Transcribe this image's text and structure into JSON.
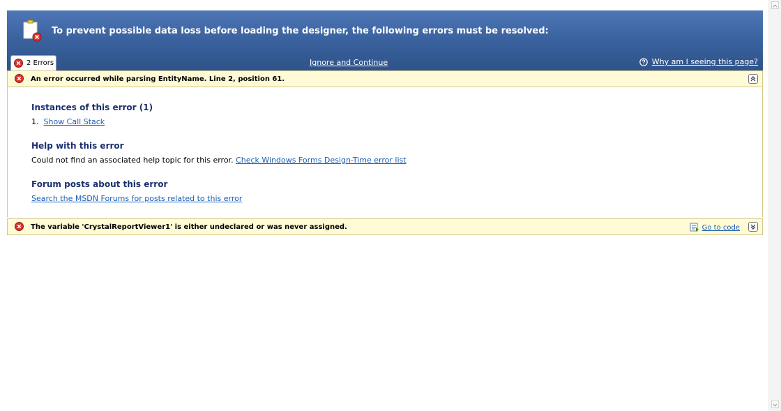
{
  "header": {
    "title": "To prevent possible data loss before loading the designer, the following errors must be resolved:",
    "tab_label": "2 Errors",
    "ignore_link": "Ignore and Continue",
    "help_link": "Why am I seeing this page?",
    "icons": {
      "document": "document-error-icon",
      "help": "question-circle-icon"
    }
  },
  "errors": [
    {
      "message": "An error occurred while parsing EntityName. Line 2, position 61.",
      "expanded": true,
      "toggle_icon": "chevron-up-double-icon",
      "instances_title": "Instances of this error (1)",
      "instance_number": "1.",
      "call_stack_link": "Show Call Stack",
      "help_title": "Help with this error",
      "help_text": "Could not find an associated help topic for this error.",
      "help_link": "Check Windows Forms Design-Time error list",
      "forum_title": "Forum posts about this error",
      "forum_link": "Search the MSDN Forums for posts related to this error"
    },
    {
      "message": "The variable 'CrystalReportViewer1' is either undeclared or was never assigned.",
      "expanded": false,
      "toggle_icon": "chevron-down-double-icon",
      "goto_link": "Go to code"
    }
  ],
  "colors": {
    "header_top": "#4f77b6",
    "header_bottom": "#2f5389",
    "error_bar_bg": "#fffbd6",
    "section_title": "#1b2f6e",
    "link": "#1a5fb4",
    "error_icon": "#d9342b"
  }
}
